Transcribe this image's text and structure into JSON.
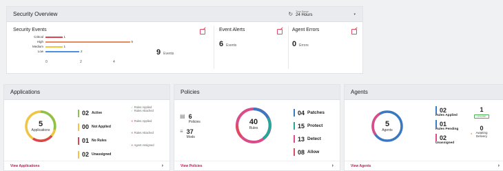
{
  "overview": {
    "title": "Security Overview",
    "time_range_label": "Time Range",
    "time_range_value": "24 Hours",
    "events": {
      "title": "Security Events",
      "count": "9",
      "count_unit": "Events",
      "levels": [
        {
          "label": "Critical",
          "value": 1,
          "value_text": "1",
          "color": "#d9464d"
        },
        {
          "label": "High",
          "value": 5,
          "value_text": "5",
          "color": "#e8895a"
        },
        {
          "label": "Medium",
          "value": 1,
          "value_text": "1",
          "color": "#f0c541"
        },
        {
          "label": "Low",
          "value": 2,
          "value_text": "2",
          "color": "#4b8fe2"
        }
      ],
      "ticks": [
        "0",
        "2",
        "4"
      ]
    },
    "alerts": {
      "title": "Event Alerts",
      "count": "6",
      "unit": "Events"
    },
    "errors": {
      "title": "Agent Errors",
      "count": "0",
      "unit": "Errors"
    }
  },
  "applications": {
    "title": "Applications",
    "donut_value": "5",
    "donut_label": "Applications",
    "stats": [
      {
        "num": "02",
        "label": "Active",
        "color": "#8bc34a"
      },
      {
        "num": "00",
        "label": "Not Applied",
        "color": "#f0c541"
      },
      {
        "num": "01",
        "label": "No Rules",
        "color": "#d9464d"
      },
      {
        "num": "02",
        "label": "Unassigned",
        "color": "#f0c541"
      }
    ],
    "notes": [
      "Rules Applied",
      "Rules Attached",
      "Rules Applied",
      "Rules Attached",
      "Agent Assigned"
    ],
    "link": "View Applications"
  },
  "policies": {
    "title": "Policies",
    "policies_count": "6",
    "policies_label": "Policies",
    "mods_count": "37",
    "mods_label": "Mods",
    "donut_value": "40",
    "donut_label": "Rules",
    "stats": [
      {
        "num": "04",
        "label": "Patches",
        "color": "#3b78c2"
      },
      {
        "num": "15",
        "label": "Protect",
        "color": "#26a69a"
      },
      {
        "num": "13",
        "label": "Detect",
        "color": "#d94c89"
      },
      {
        "num": "08",
        "label": "Allow",
        "color": "#e0495e"
      }
    ],
    "link": "View Policies"
  },
  "agents": {
    "title": "Agents",
    "donut_value": "5",
    "donut_label": "Agents",
    "stats": [
      {
        "num": "02",
        "label": "Rules Applied",
        "color": "#3b78c2"
      },
      {
        "num": "01",
        "label": "Rules Pending",
        "color": "#3b78c2"
      },
      {
        "num": "02",
        "label": "Unassigned",
        "color": "#d94c89"
      }
    ],
    "online_count": "1",
    "online_label": "ONLINE",
    "pending_count": "0",
    "pending_label1": "Awaiting",
    "pending_label2": "Delivery",
    "link": "View Agents"
  }
}
